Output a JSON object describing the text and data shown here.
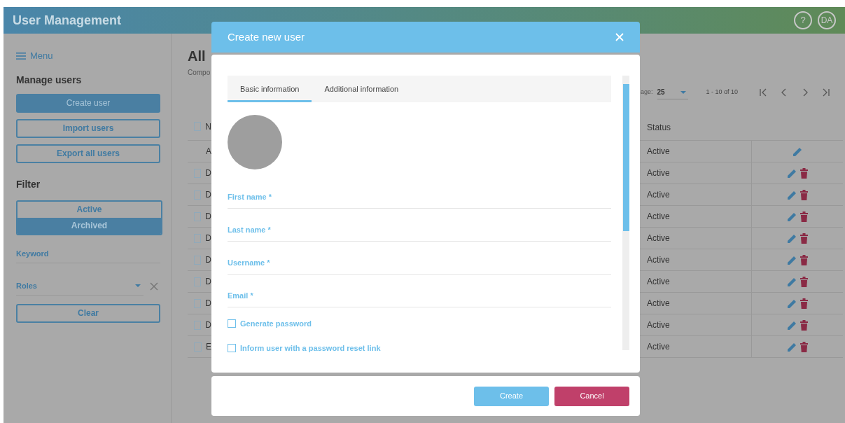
{
  "header": {
    "title": "User Management",
    "help": "?",
    "avatar": "DA"
  },
  "sidebar": {
    "menu": "Menu",
    "section": "Manage users",
    "actions": [
      {
        "label": "Create user",
        "kind": "primary"
      },
      {
        "label": "Import users",
        "kind": "outline"
      },
      {
        "label": "Export all users",
        "kind": "outline"
      }
    ],
    "filter_title": "Filter",
    "status_filter": [
      {
        "label": "Active",
        "selected": false
      },
      {
        "label": "Archived",
        "selected": true
      }
    ],
    "keyword": {
      "placeholder": "Keyword"
    },
    "roles": {
      "placeholder": "Roles"
    },
    "clear": "Clear"
  },
  "main": {
    "title": "All",
    "subtitle": "Compo",
    "pagination": {
      "label": "age:",
      "page_size": "25",
      "range": "1 - 10 of 10"
    },
    "table": {
      "header": {
        "column_1": "N",
        "status": "Status",
        "checked": false
      },
      "rows": [
        {
          "column_1": "A",
          "status": "Active",
          "deletable": false
        },
        {
          "column_1": "D",
          "checked": false,
          "status": "Active",
          "deletable": true
        },
        {
          "column_1": "D",
          "checked": false,
          "status": "Active",
          "deletable": true
        },
        {
          "column_1": "D",
          "checked": false,
          "status": "Active",
          "deletable": true
        },
        {
          "column_1": "D",
          "checked": false,
          "status": "Active",
          "deletable": true
        },
        {
          "column_1": "D",
          "checked": false,
          "status": "Active",
          "deletable": true
        },
        {
          "column_1": "D",
          "checked": false,
          "status": "Active",
          "deletable": true
        },
        {
          "column_1": "D",
          "checked": false,
          "status": "Active",
          "deletable": true
        },
        {
          "column_1": "D",
          "checked": false,
          "status": "Active",
          "deletable": true
        },
        {
          "column_1": "E",
          "checked": false,
          "status": "Active",
          "deletable": true
        }
      ]
    }
  },
  "dialog": {
    "title": "Create new user",
    "tabs": [
      {
        "label": "Basic information",
        "selected": true
      },
      {
        "label": "Additional information",
        "selected": false
      }
    ],
    "fields": [
      {
        "label": "First name *"
      },
      {
        "label": "Last name *"
      },
      {
        "label": "Username *"
      },
      {
        "label": "Email *"
      }
    ],
    "options": [
      {
        "label": "Generate password",
        "checked": false
      },
      {
        "label": "Inform user with a password reset link",
        "checked": false
      }
    ],
    "buttons": [
      {
        "label": "Create",
        "kind": "primary"
      },
      {
        "label": "Cancel",
        "kind": "danger"
      }
    ]
  }
}
